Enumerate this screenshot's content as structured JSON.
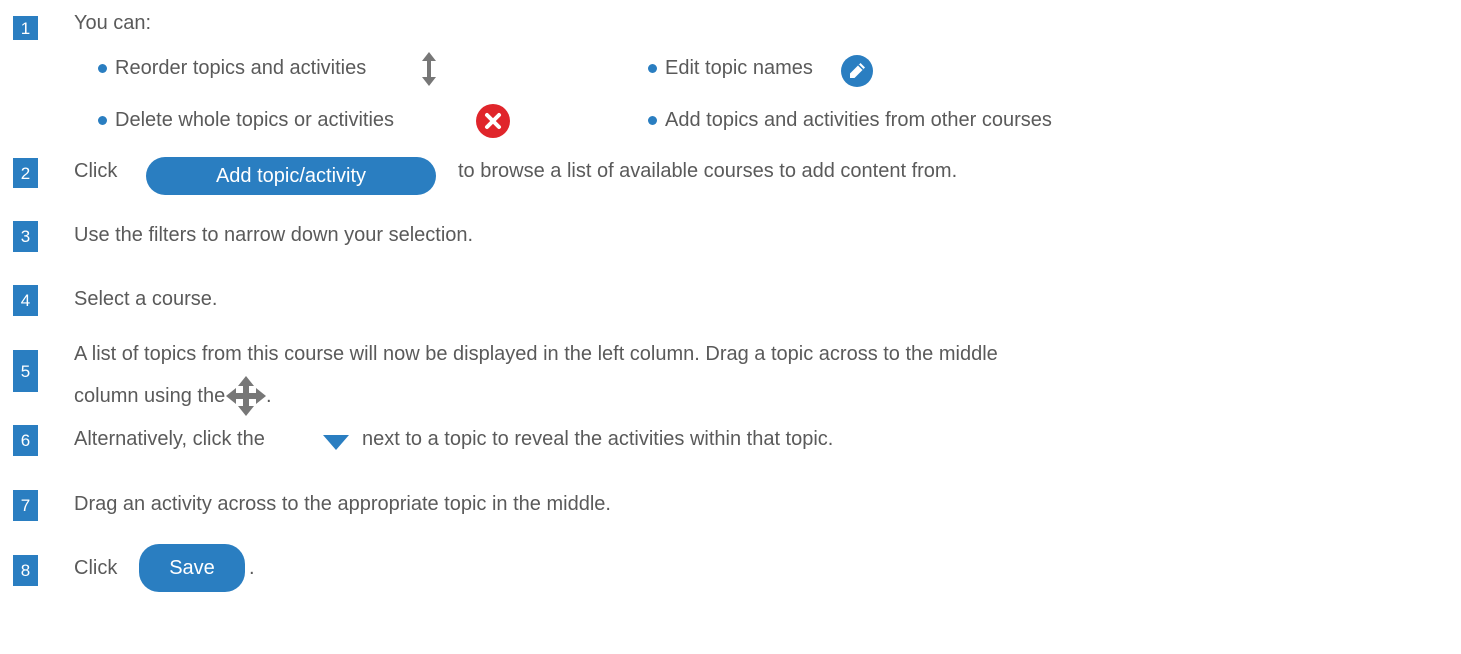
{
  "steps": [
    {
      "num": "1",
      "text": "You can:"
    },
    {
      "num": "2",
      "before": "Click",
      "button": "Add topic/activity",
      "after": "to browse a list of available courses to add content from."
    },
    {
      "num": "3",
      "text": "Use the filters to narrow down your selection."
    },
    {
      "num": "4",
      "text": "Select a course."
    },
    {
      "num": "5",
      "line1": "A list of topics from this course will now be displayed in the left column. Drag a topic across to the middle",
      "line2": "column using the",
      "line2_end": "."
    },
    {
      "num": "6",
      "before": "Alternatively, click the",
      "after": "next to a topic to reveal the activities within that topic."
    },
    {
      "num": "7",
      "text": "Drag an activity across to the appropriate topic in the middle."
    },
    {
      "num": "8",
      "before": "Click",
      "button": "Save",
      "after": "."
    }
  ],
  "bullets": [
    {
      "text": "Reorder topics and activities",
      "icon": "reorder-arrow-icon"
    },
    {
      "text": "Edit topic names",
      "icon": "pencil-icon"
    },
    {
      "text": "Delete whole topics or activities",
      "icon": "delete-x-icon"
    },
    {
      "text": "Add topics and activities from other courses"
    }
  ],
  "colors": {
    "accent": "#2a7ec1",
    "text": "#5a5a5a",
    "delete": "#e0252b",
    "icon_gray": "#777777"
  },
  "icons": {
    "step5": "move-arrows-icon",
    "step6": "triangle-down-icon"
  }
}
